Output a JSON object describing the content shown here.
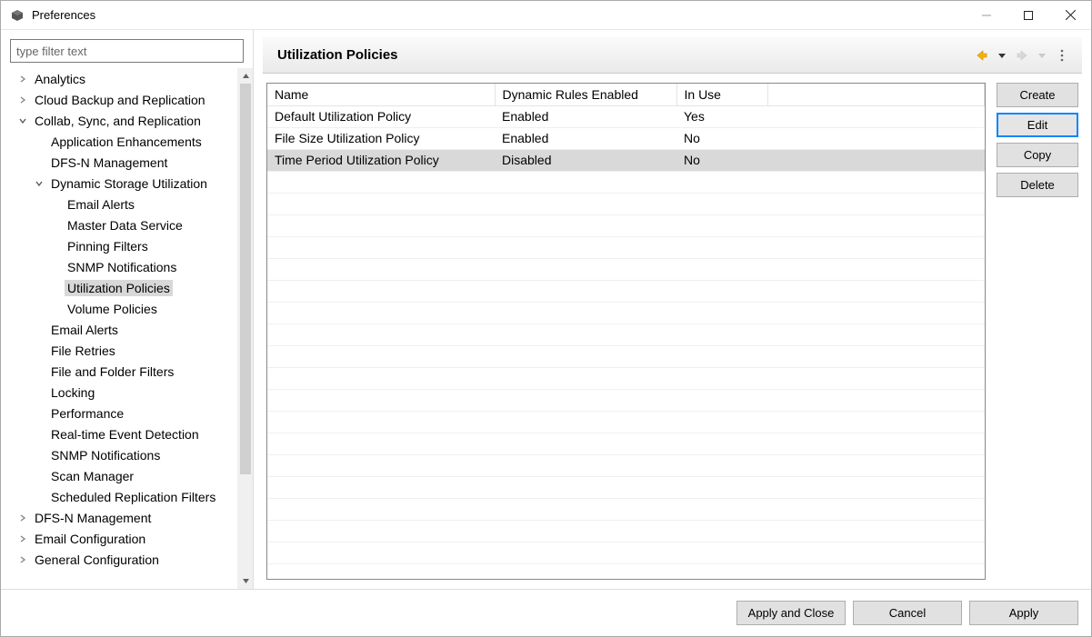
{
  "window": {
    "title": "Preferences"
  },
  "sidebar": {
    "filter_placeholder": "type filter text",
    "items": [
      {
        "label": "Analytics",
        "level": 0,
        "twisty": "closed"
      },
      {
        "label": "Cloud Backup and Replication",
        "level": 0,
        "twisty": "closed"
      },
      {
        "label": "Collab, Sync, and Replication",
        "level": 0,
        "twisty": "open"
      },
      {
        "label": "Application Enhancements",
        "level": 1,
        "twisty": "none"
      },
      {
        "label": "DFS-N Management",
        "level": 1,
        "twisty": "none"
      },
      {
        "label": "Dynamic Storage Utilization",
        "level": 1,
        "twisty": "open"
      },
      {
        "label": "Email Alerts",
        "level": 2,
        "twisty": "none"
      },
      {
        "label": "Master Data Service",
        "level": 2,
        "twisty": "none"
      },
      {
        "label": "Pinning Filters",
        "level": 2,
        "twisty": "none"
      },
      {
        "label": "SNMP Notifications",
        "level": 2,
        "twisty": "none"
      },
      {
        "label": "Utilization Policies",
        "level": 2,
        "twisty": "none",
        "selected": true
      },
      {
        "label": "Volume Policies",
        "level": 2,
        "twisty": "none"
      },
      {
        "label": "Email Alerts",
        "level": 1,
        "twisty": "none"
      },
      {
        "label": "File Retries",
        "level": 1,
        "twisty": "none"
      },
      {
        "label": "File and Folder Filters",
        "level": 1,
        "twisty": "none"
      },
      {
        "label": "Locking",
        "level": 1,
        "twisty": "none"
      },
      {
        "label": "Performance",
        "level": 1,
        "twisty": "none"
      },
      {
        "label": "Real-time Event Detection",
        "level": 1,
        "twisty": "none"
      },
      {
        "label": "SNMP Notifications",
        "level": 1,
        "twisty": "none"
      },
      {
        "label": "Scan Manager",
        "level": 1,
        "twisty": "none"
      },
      {
        "label": "Scheduled Replication Filters",
        "level": 1,
        "twisty": "none"
      },
      {
        "label": "DFS-N Management",
        "level": 0,
        "twisty": "closed"
      },
      {
        "label": "Email Configuration",
        "level": 0,
        "twisty": "closed"
      },
      {
        "label": "General Configuration",
        "level": 0,
        "twisty": "closed"
      }
    ]
  },
  "content": {
    "title": "Utilization Policies",
    "table": {
      "headers": {
        "name": "Name",
        "dyn": "Dynamic Rules Enabled",
        "use": "In Use"
      },
      "rows": [
        {
          "name": "Default Utilization Policy",
          "dyn": "Enabled",
          "use": "Yes",
          "selected": false
        },
        {
          "name": "File Size Utilization Policy",
          "dyn": "Enabled",
          "use": "No",
          "selected": false
        },
        {
          "name": "Time Period Utilization Policy",
          "dyn": "Disabled",
          "use": "No",
          "selected": true
        }
      ]
    },
    "buttons": {
      "create": "Create",
      "edit": "Edit",
      "copy": "Copy",
      "delete": "Delete"
    }
  },
  "footer": {
    "apply_and_close": "Apply and Close",
    "cancel": "Cancel",
    "apply": "Apply"
  }
}
